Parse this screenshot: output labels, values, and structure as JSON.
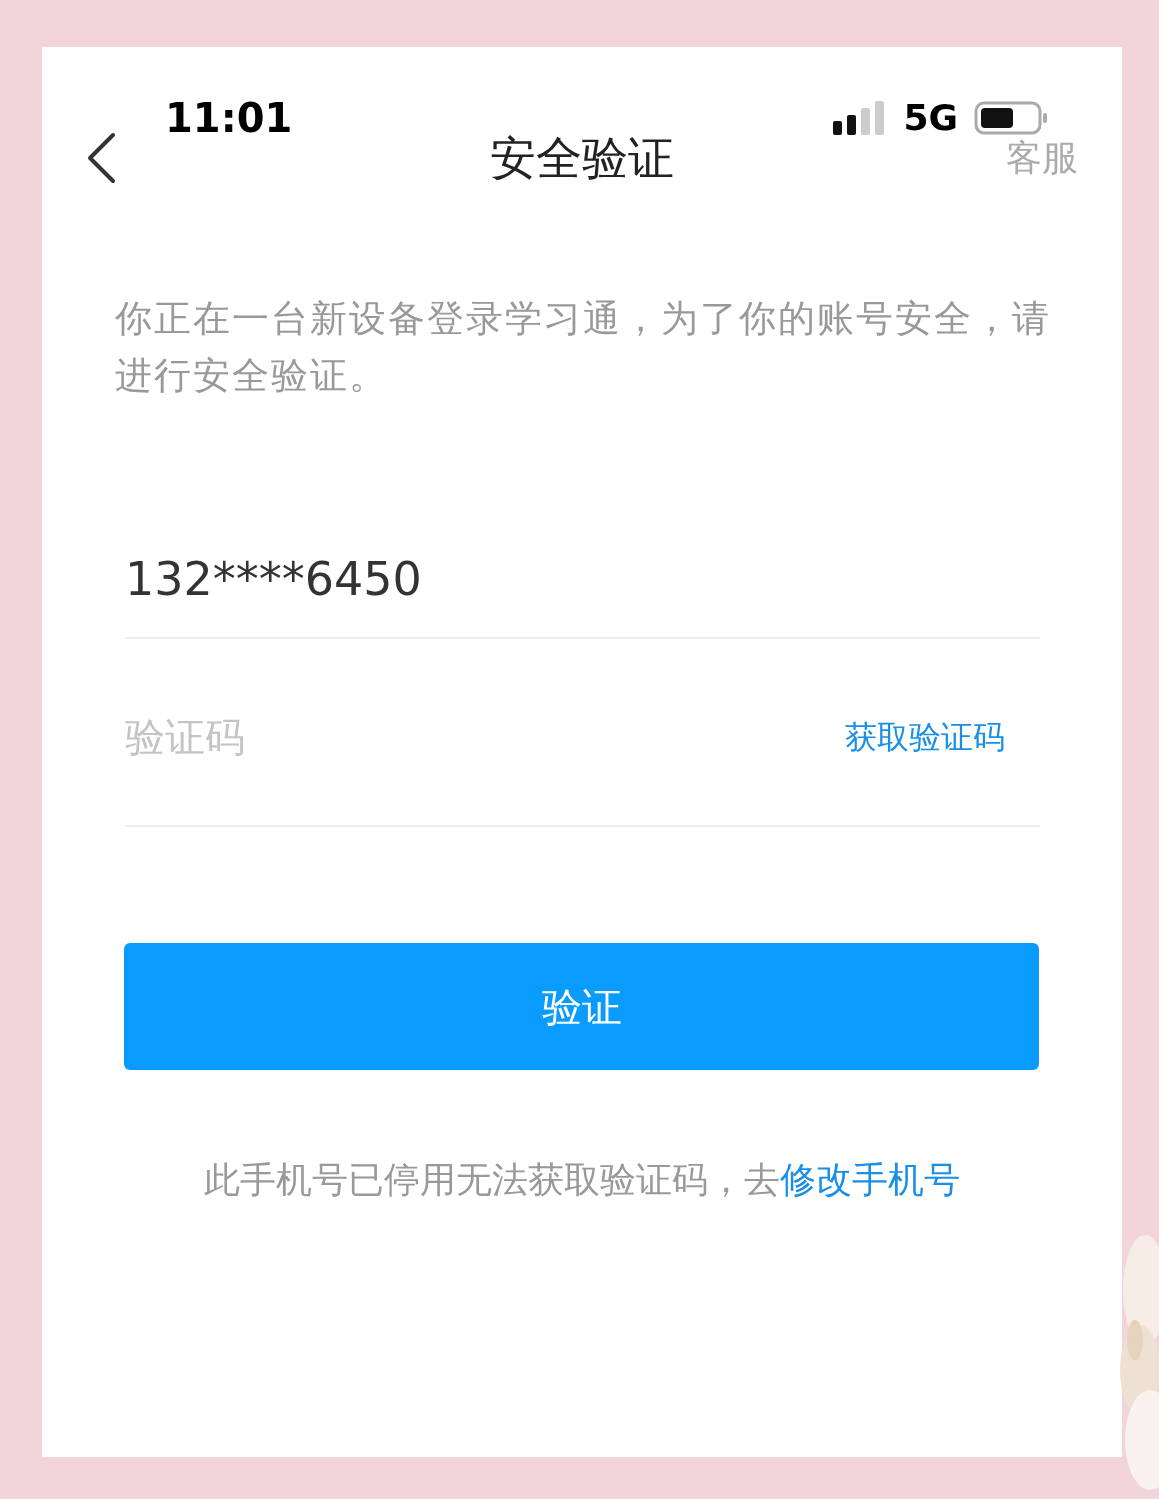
{
  "status_bar": {
    "time": "11:01",
    "network": "5G"
  },
  "header": {
    "title": "安全验证",
    "right_action": "客服"
  },
  "notice": "你正在一台新设备登录学习通，为了你的账号安全，请进行安全验证。",
  "phone_field": {
    "value": "132****6450"
  },
  "code_field": {
    "placeholder": "验证码",
    "action": "获取验证码"
  },
  "submit_button": "验证",
  "footer": {
    "text": "此手机号已停用无法获取验证码，去",
    "link": "修改手机号"
  }
}
